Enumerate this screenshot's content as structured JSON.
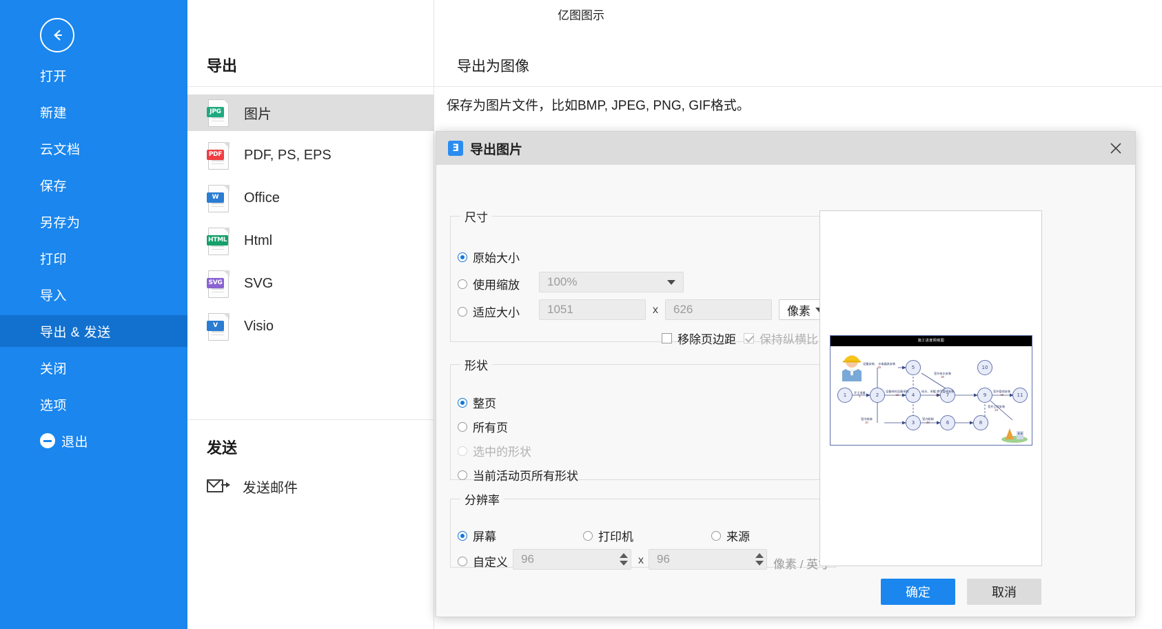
{
  "app": {
    "title": "亿图图示"
  },
  "sidebar": {
    "back_icon": "back-arrow-icon",
    "items": [
      {
        "label": "打开",
        "active": false
      },
      {
        "label": "新建",
        "active": false
      },
      {
        "label": "云文档",
        "active": false
      },
      {
        "label": "保存",
        "active": false
      },
      {
        "label": "另存为",
        "active": false
      },
      {
        "label": "打印",
        "active": false
      },
      {
        "label": "导入",
        "active": false
      },
      {
        "label": "导出 & 发送",
        "active": true
      },
      {
        "label": "关闭",
        "active": false
      },
      {
        "label": "选项",
        "active": false
      },
      {
        "label": "退出",
        "active": false
      }
    ]
  },
  "export_panel": {
    "export_heading": "导出",
    "send_heading": "发送",
    "formats": [
      {
        "label": "图片",
        "tag": "JPG",
        "icon": "jpg-file-icon",
        "active": true
      },
      {
        "label": "PDF, PS, EPS",
        "tag": "PDF",
        "icon": "pdf-file-icon",
        "active": false
      },
      {
        "label": "Office",
        "tag": "W",
        "icon": "word-file-icon",
        "active": false
      },
      {
        "label": "Html",
        "tag": "HTML",
        "icon": "html-file-icon",
        "active": false
      },
      {
        "label": "SVG",
        "tag": "SVG",
        "icon": "svg-file-icon",
        "active": false
      },
      {
        "label": "Visio",
        "tag": "V",
        "icon": "visio-file-icon",
        "active": false
      }
    ],
    "send_items": [
      {
        "label": "发送邮件",
        "icon": "mail-send-icon"
      }
    ]
  },
  "main": {
    "heading": "导出为图像",
    "description": "保存为图片文件，比如BMP, JPEG, PNG, GIF格式。"
  },
  "dialog": {
    "title": "导出图片",
    "logo_glyph": "Ǝ",
    "close_icon": "close-icon",
    "size": {
      "legend": "尺寸",
      "original_label": "原始大小",
      "original_selected": true,
      "scale_label": "使用缩放",
      "scale_selected": false,
      "scale_value": "100%",
      "fit_label": "适应大小",
      "fit_selected": false,
      "width_value": "1051",
      "height_value": "626",
      "x_sep": "x",
      "unit_value": "像素",
      "remove_margin_label": "移除页边距",
      "remove_margin_checked": false,
      "keep_ratio_label": "保持纵横比",
      "keep_ratio_checked": true,
      "keep_ratio_disabled": true
    },
    "shape": {
      "legend": "形状",
      "options": [
        {
          "label": "整页",
          "selected": true,
          "disabled": false
        },
        {
          "label": "所有页",
          "selected": false,
          "disabled": false
        },
        {
          "label": "选中的形状",
          "selected": false,
          "disabled": true
        },
        {
          "label": "当前活动页所有形状",
          "selected": false,
          "disabled": false
        }
      ]
    },
    "resolution": {
      "legend": "分辨率",
      "options": [
        {
          "label": "屏幕",
          "selected": true
        },
        {
          "label": "打印机",
          "selected": false
        },
        {
          "label": "来源",
          "selected": false
        }
      ],
      "custom_label": "自定义",
      "custom_selected": false,
      "dpi_x": "96",
      "dpi_y": "96",
      "x_sep": "x",
      "unit_label": "像素 / 英寸"
    },
    "preview": {
      "name": "export-preview",
      "diagram_title": "施工进度网络图",
      "nodes": [
        "1",
        "2",
        "3",
        "4",
        "5",
        "6",
        "7",
        "8",
        "9",
        "10",
        "11"
      ],
      "edge_labels": [
        {
          "text": "开工准备",
          "dur": "5"
        },
        {
          "text": "设备材料设备采购",
          "dur": "15"
        },
        {
          "text": "设备安装、\n水电器具安装",
          "dur": "15"
        },
        {
          "text": "室内装修",
          "dur": "10"
        },
        {
          "text": "给水、采暖\n燃气管线安装",
          "dur": "20"
        },
        {
          "text": "室内粉刷",
          "dur": "20"
        },
        {
          "text": "室外管线安装",
          "dur": "45"
        },
        {
          "text": "室外给水安装",
          "dur": "30"
        },
        {
          "text": "室外工程安装",
          "dur": "25"
        },
        {
          "text": "场地平整",
          "dur": "18"
        }
      ]
    },
    "buttons": {
      "ok": "确定",
      "cancel": "取消"
    }
  },
  "colors": {
    "sidebar_blue": "#1a86ee",
    "sidebar_active": "#1271cf",
    "primary": "#1a86ee",
    "dialog_header": "#dcdcdc",
    "field_bg": "#ececec"
  }
}
